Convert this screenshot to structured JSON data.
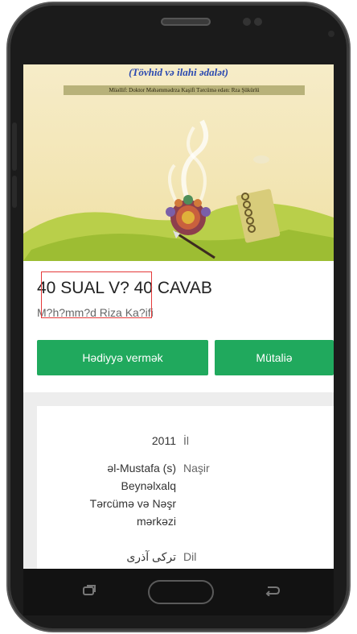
{
  "cover": {
    "subtitle": "(Tövhid və ilahi ədalət)",
    "credits": "Müəllif: Doktor Məhəmmədrza Kaşifi  Tərcümə edən: Rza Şükürlü"
  },
  "book": {
    "title": "40 SUAL V? 40 CAVAB",
    "author": "M?h?mm?d Riza Ka?ifi"
  },
  "actions": {
    "gift_label": "Hədiyyə vermək",
    "read_label": "Mütaliə"
  },
  "details": [
    {
      "label": "İl",
      "value": "2011"
    },
    {
      "label": "Naşir",
      "value_lines": [
        "əl-Mustafa (s)",
        "Beynəlxalq",
        "Tərcümə və Nəşr",
        "mərkəzi"
      ]
    },
    {
      "label": "Dil",
      "value": "ترکی آذری"
    }
  ],
  "colors": {
    "accent_green": "#20a95d",
    "highlight_red": "#e53a3a"
  },
  "nav": {
    "back_icon": "back-icon",
    "home_icon": "home-button",
    "recent_icon": "recent-apps-icon"
  }
}
